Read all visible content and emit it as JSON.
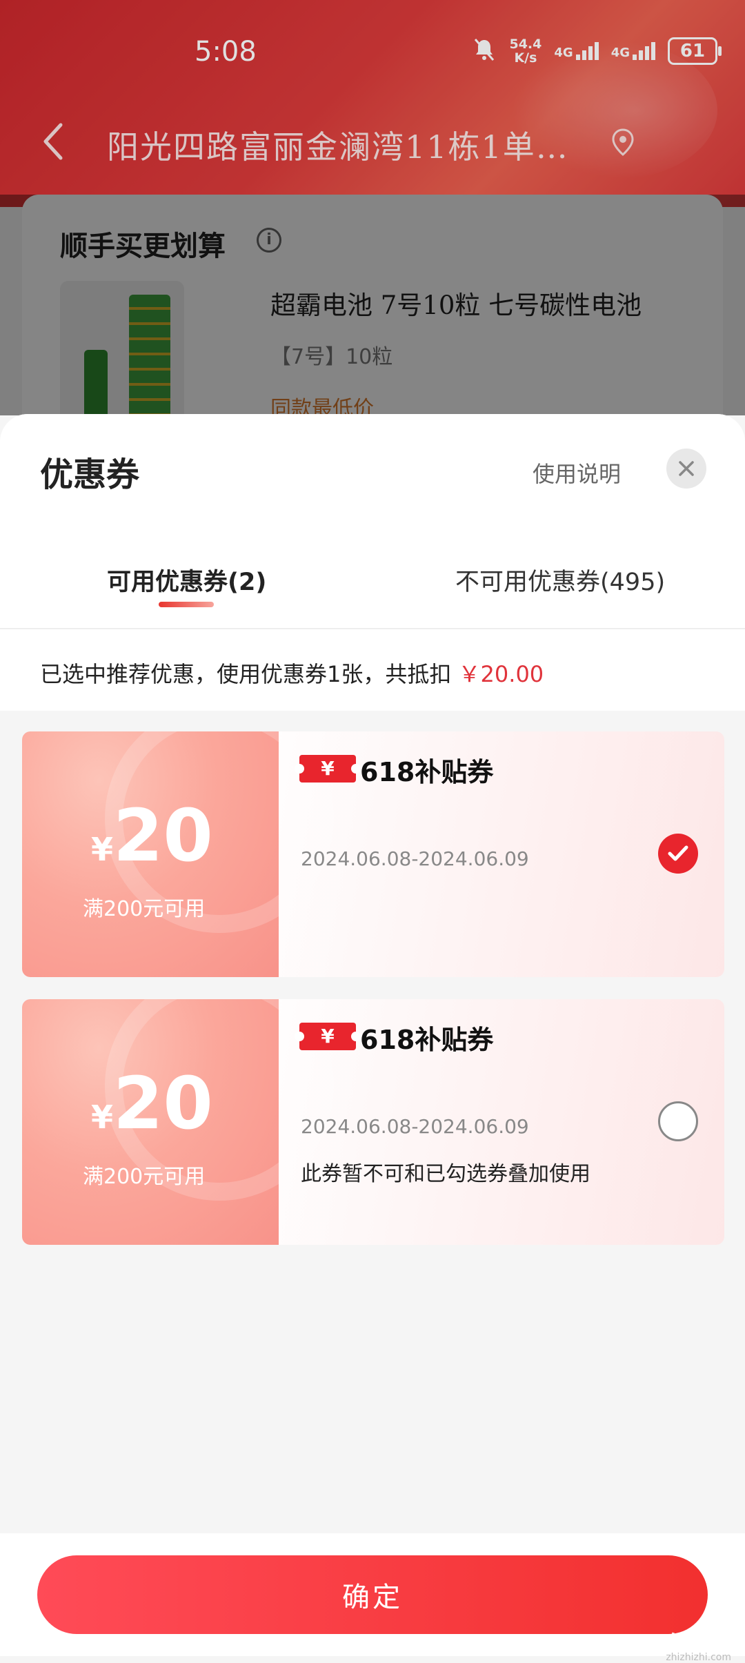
{
  "status_bar": {
    "time": "5:08",
    "net_speed_value": "54.4",
    "net_speed_unit": "K/s",
    "signal_1": "4G",
    "signal_2": "4G",
    "battery": "61"
  },
  "header": {
    "address": "阳光四路富丽金澜湾11栋1单…",
    "icons": [
      "back-icon",
      "location-pin-icon"
    ]
  },
  "background_card": {
    "title": "顺手买更划算",
    "product_name": "超霸电池 7号10粒 七号碳性电池",
    "product_spec": "【7号】10粒",
    "product_tag": "同款最低价"
  },
  "sheet": {
    "title": "优惠券",
    "usage_link": "使用说明",
    "tabs": [
      {
        "label": "可用优惠券(2)",
        "active": true
      },
      {
        "label": "不可用优惠券(495)",
        "active": false
      }
    ],
    "summary_prefix": "已选中推荐优惠，使用优惠券1张，共抵扣",
    "summary_amount": "￥20.00"
  },
  "coupons": [
    {
      "currency": "¥",
      "value": "20",
      "condition": "满200元可用",
      "tag": "¥",
      "name": "618补贴券",
      "date_range": "2024.06.08-2024.06.09",
      "note": "",
      "selected": true
    },
    {
      "currency": "¥",
      "value": "20",
      "condition": "满200元可用",
      "tag": "¥",
      "name": "618补贴券",
      "date_range": "2024.06.08-2024.06.09",
      "note": "此券暂不可和已勾选券叠加使用",
      "selected": false
    }
  ],
  "footer": {
    "confirm_label": "确定",
    "watermark": "值值值",
    "watermark_site": "zhizhizhi.com"
  },
  "colors": {
    "accent": "#e8252d",
    "header_red": "#c8272c",
    "amount_red": "#e0333b"
  }
}
